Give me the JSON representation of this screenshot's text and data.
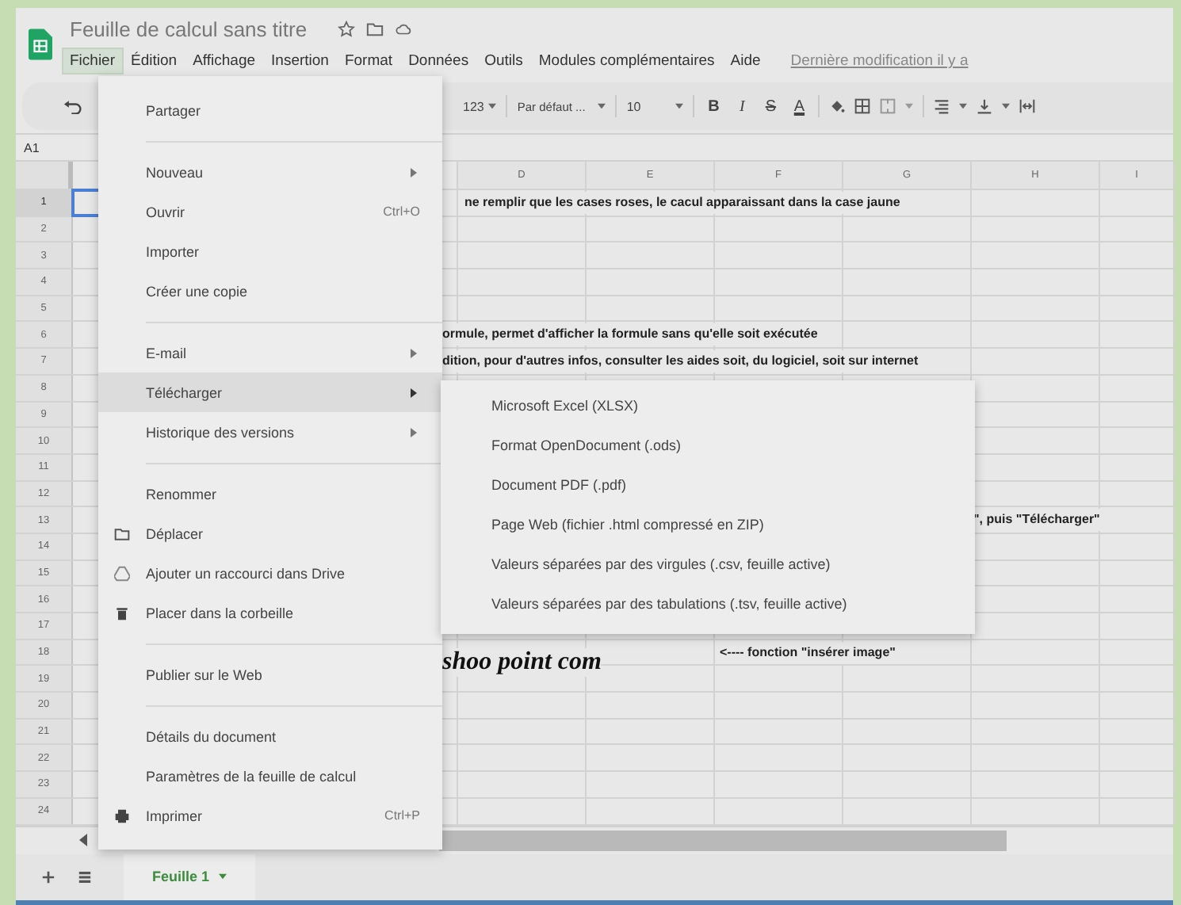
{
  "app": {
    "title": "Feuille de calcul sans titre"
  },
  "menubar": [
    {
      "label": "Fichier",
      "selected": true
    },
    {
      "label": "Édition",
      "selected": false
    },
    {
      "label": "Affichage",
      "selected": false
    },
    {
      "label": "Insertion",
      "selected": false
    },
    {
      "label": "Format",
      "selected": false
    },
    {
      "label": "Données",
      "selected": false
    },
    {
      "label": "Outils",
      "selected": false
    },
    {
      "label": "Modules complémentaires",
      "selected": false
    },
    {
      "label": "Aide",
      "selected": false
    }
  ],
  "last_edit": "Dernière modification il y a",
  "toolbar": {
    "number_format": "123",
    "font": "Par défaut ...",
    "font_size": "10",
    "style_buttons": [
      {
        "label": "B",
        "kind": "bold"
      },
      {
        "label": "I",
        "kind": "italic"
      },
      {
        "label": "S",
        "kind": "strike"
      },
      {
        "label": "A",
        "kind": "color"
      }
    ]
  },
  "name_box": "A1",
  "columns": [
    "D",
    "E",
    "F",
    "G",
    "H",
    "I"
  ],
  "rows": [
    {
      "number": "1",
      "selected": true,
      "texts": [
        {
          "text": "ne remplir que les cases roses, le cacul apparaissant dans la case jaune",
          "kind": "title"
        }
      ]
    },
    {
      "number": "2",
      "selected": false
    },
    {
      "number": "3",
      "selected": false
    },
    {
      "number": "4",
      "selected": false
    },
    {
      "number": "5",
      "selected": false
    },
    {
      "number": "6",
      "selected": false,
      "texts": [
        {
          "text": "ormule, permet d'afficher la formule sans qu'elle soit exécutée",
          "kind": "overflow"
        }
      ]
    },
    {
      "number": "7",
      "selected": false,
      "texts": [
        {
          "text": "dition, pour d'autres infos, consulter les aides soit, du logiciel, soit sur internet",
          "kind": "overflow"
        }
      ]
    },
    {
      "number": "8",
      "selected": false
    },
    {
      "number": "9",
      "selected": false
    },
    {
      "number": "10",
      "selected": false
    },
    {
      "number": "11",
      "selected": false
    },
    {
      "number": "12",
      "selected": false
    },
    {
      "number": "13",
      "selected": false,
      "texts": [
        {
          "text": "\", puis \"Télécharger\"",
          "kind": "tail"
        }
      ]
    },
    {
      "number": "14",
      "selected": false
    },
    {
      "number": "15",
      "selected": false
    },
    {
      "number": "16",
      "selected": false
    },
    {
      "number": "17",
      "selected": false
    },
    {
      "number": "18",
      "selected": false,
      "texts": [
        {
          "text": "<---- fonction \"insérer image\"",
          "kind": "arrow"
        }
      ]
    },
    {
      "number": "19",
      "selected": false
    },
    {
      "number": "20",
      "selected": false
    },
    {
      "number": "21",
      "selected": false
    },
    {
      "number": "22",
      "selected": false
    },
    {
      "number": "23",
      "selected": false
    },
    {
      "number": "24",
      "selected": false
    }
  ],
  "drawing_text": "shoo point com",
  "file_menu": [
    {
      "kind": "item",
      "label": "Partager",
      "highlighted": false,
      "submenu": false
    },
    {
      "kind": "separator"
    },
    {
      "kind": "item",
      "label": "Nouveau",
      "highlighted": false,
      "submenu": true
    },
    {
      "kind": "item",
      "label": "Ouvrir",
      "shortcut": "Ctrl+O",
      "highlighted": false,
      "submenu": false
    },
    {
      "kind": "item",
      "label": "Importer",
      "highlighted": false,
      "submenu": false
    },
    {
      "kind": "item",
      "label": "Créer une copie",
      "highlighted": false,
      "submenu": false
    },
    {
      "kind": "separator"
    },
    {
      "kind": "item",
      "label": "E-mail",
      "highlighted": false,
      "submenu": true
    },
    {
      "kind": "item",
      "label": "Télécharger",
      "highlighted": true,
      "submenu": true
    },
    {
      "kind": "item",
      "label": "Historique des versions",
      "highlighted": false,
      "submenu": true
    },
    {
      "kind": "separator"
    },
    {
      "kind": "item",
      "label": "Renommer",
      "highlighted": false,
      "submenu": false
    },
    {
      "kind": "folder",
      "label": "Déplacer",
      "highlighted": false,
      "submenu": false
    },
    {
      "kind": "drive",
      "label": "Ajouter un raccourci dans Drive",
      "highlighted": false,
      "submenu": false
    },
    {
      "kind": "trash",
      "label": "Placer dans la corbeille",
      "highlighted": false,
      "submenu": false
    },
    {
      "kind": "separator"
    },
    {
      "kind": "item",
      "label": "Publier sur le Web",
      "highlighted": false,
      "submenu": false
    },
    {
      "kind": "separator"
    },
    {
      "kind": "item",
      "label": "Détails du document",
      "highlighted": false,
      "submenu": false
    },
    {
      "kind": "item",
      "label": "Paramètres de la feuille de calcul",
      "highlighted": false,
      "submenu": false
    },
    {
      "kind": "printer",
      "label": "Imprimer",
      "shortcut": "Ctrl+P",
      "highlighted": false,
      "submenu": false
    }
  ],
  "download_submenu": [
    "Microsoft Excel (XLSX)",
    "Format OpenDocument (.ods)",
    "Document PDF (.pdf)",
    "Page Web (fichier .html compressé en ZIP)",
    "Valeurs séparées par des virgules (.csv, feuille active)",
    "Valeurs séparées par des tabulations (.tsv, feuille active)"
  ],
  "sheets": [
    {
      "label": "Feuille 1",
      "selected": true
    }
  ]
}
